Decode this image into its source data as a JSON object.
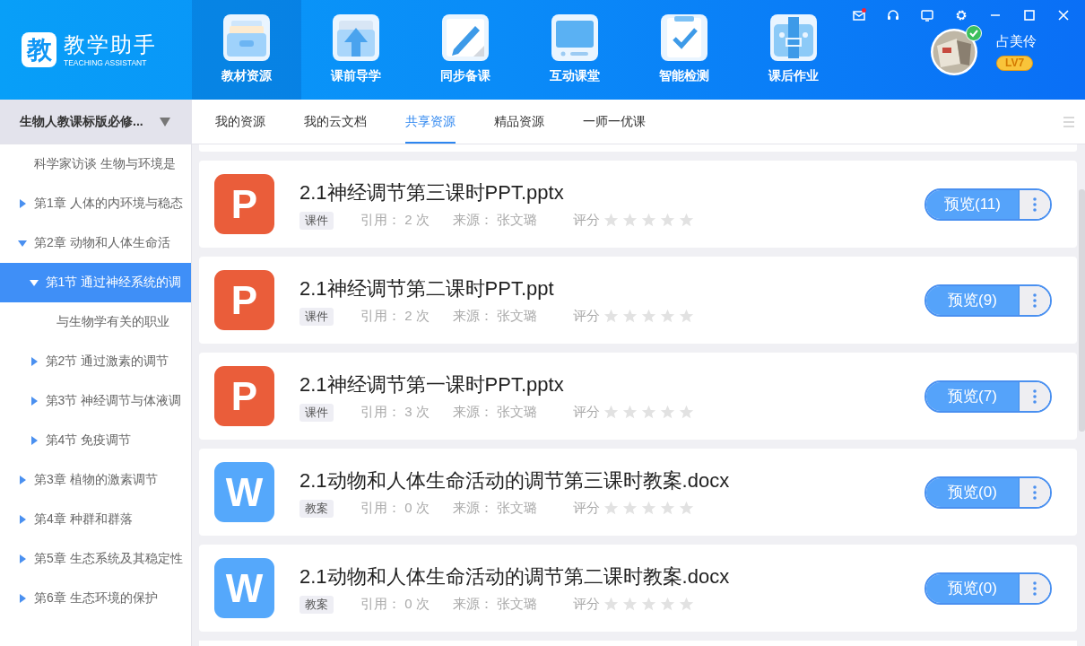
{
  "app": {
    "logo_char": "教",
    "title": "教学助手",
    "subtitle": "TEACHING ASSISTANT"
  },
  "nav": [
    {
      "label": "教材资源",
      "kind": "drawer",
      "selected": true
    },
    {
      "label": "课前导学",
      "kind": "upload",
      "selected": false
    },
    {
      "label": "同步备课",
      "kind": "pencil",
      "selected": false
    },
    {
      "label": "互动课堂",
      "kind": "screen",
      "selected": false
    },
    {
      "label": "智能检测",
      "kind": "check",
      "selected": false
    },
    {
      "label": "课后作业",
      "kind": "bag",
      "selected": false
    }
  ],
  "window_controls": [
    {
      "kind": "mail",
      "unread": true
    },
    {
      "kind": "headset"
    },
    {
      "kind": "chat"
    },
    {
      "kind": "settings"
    },
    {
      "kind": "minimize"
    },
    {
      "kind": "maximize"
    },
    {
      "kind": "close"
    }
  ],
  "user": {
    "name": "占美伶",
    "level": "LV7",
    "verified": true
  },
  "course_selector": {
    "value": "生物人教课标版必修..."
  },
  "tabs": [
    {
      "label": "我的资源",
      "selected": false
    },
    {
      "label": "我的云文档",
      "selected": false
    },
    {
      "label": "共享资源",
      "selected": true
    },
    {
      "label": "精品资源",
      "selected": false
    },
    {
      "label": "一师一优课",
      "selected": false
    }
  ],
  "tree": [
    {
      "label": "科学家访谈 生物与环境是",
      "selected": false
    },
    {
      "label": "第1章 人体的内环境与稳态",
      "expanded": false,
      "selected": false
    },
    {
      "label": "第2章 动物和人体生命活",
      "expanded": true,
      "selected": false,
      "children": [
        {
          "label": "第1节 通过神经系统的调",
          "expanded": true,
          "selected": true,
          "children": [
            {
              "label": "与生物学有关的职业",
              "selected": false
            }
          ]
        },
        {
          "label": "第2节 通过激素的调节",
          "expanded": false,
          "selected": false
        },
        {
          "label": "第3节 神经调节与体液调",
          "expanded": false,
          "selected": false
        },
        {
          "label": "第4节 免疫调节",
          "expanded": false,
          "selected": false
        }
      ]
    },
    {
      "label": "第3章 植物的激素调节",
      "expanded": false,
      "selected": false
    },
    {
      "label": "第4章 种群和群落",
      "expanded": false,
      "selected": false
    },
    {
      "label": "第5章 生态系统及其稳定性",
      "expanded": false,
      "selected": false
    },
    {
      "label": "第6章 生态环境的保护",
      "expanded": false,
      "selected": false
    }
  ],
  "resources": [
    {
      "kind": "ppt",
      "icon_letter": "P",
      "title": "2.1神经调节第三课时PPT.pptx",
      "tag": "课件",
      "citations": "引用： 2 次",
      "source": "来源： 张文璐",
      "rating_label": "评分",
      "stars": 0,
      "preview": "预览(11)"
    },
    {
      "kind": "ppt",
      "icon_letter": "P",
      "title": "2.1神经调节第二课时PPT.ppt",
      "tag": "课件",
      "citations": "引用： 2 次",
      "source": "来源： 张文璐",
      "rating_label": "评分",
      "stars": 0,
      "preview": "预览(9)"
    },
    {
      "kind": "ppt",
      "icon_letter": "P",
      "title": "2.1神经调节第一课时PPT.pptx",
      "tag": "课件",
      "citations": "引用： 3 次",
      "source": "来源： 张文璐",
      "rating_label": "评分",
      "stars": 0,
      "preview": "预览(7)"
    },
    {
      "kind": "word",
      "icon_letter": "W",
      "title": "2.1动物和人体生命活动的调节第三课时教案.docx",
      "tag": "教案",
      "citations": "引用： 0 次",
      "source": "来源： 张文璐",
      "rating_label": "评分",
      "stars": 0,
      "preview": "预览(0)"
    },
    {
      "kind": "word",
      "icon_letter": "W",
      "title": "2.1动物和人体生命活动的调节第二课时教案.docx",
      "tag": "教案",
      "citations": "引用： 0 次",
      "source": "来源： 张文璐",
      "rating_label": "评分",
      "stars": 0,
      "preview": "预览(0)"
    }
  ]
}
